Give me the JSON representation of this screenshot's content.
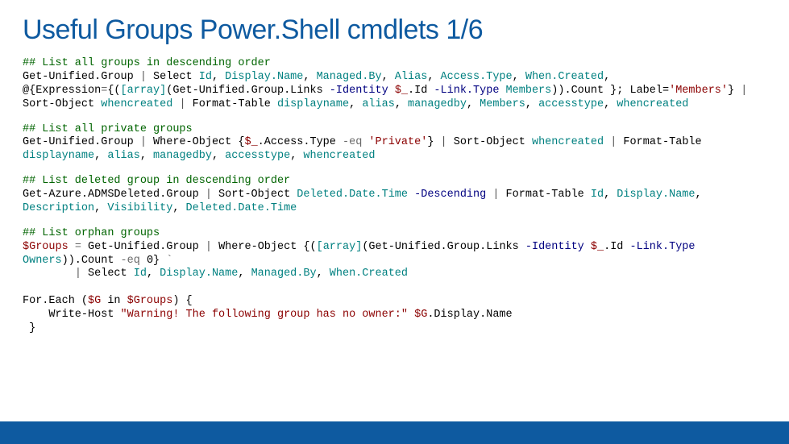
{
  "title": "Useful Groups Power.Shell cmdlets 1/6",
  "sections": [
    {
      "comment": "## List all groups in descending order",
      "tokens": [
        {
          "t": "Get-Unified.Group ",
          "c": ""
        },
        {
          "t": "|",
          "c": "pipe"
        },
        {
          "t": " Select ",
          "c": ""
        },
        {
          "t": "Id",
          "c": "teal"
        },
        {
          "t": ", ",
          "c": ""
        },
        {
          "t": "Display.Name",
          "c": "teal"
        },
        {
          "t": ", ",
          "c": ""
        },
        {
          "t": "Managed.By",
          "c": "teal"
        },
        {
          "t": ", ",
          "c": ""
        },
        {
          "t": "Alias",
          "c": "teal"
        },
        {
          "t": ", ",
          "c": ""
        },
        {
          "t": "Access.Type",
          "c": "teal"
        },
        {
          "t": ", ",
          "c": ""
        },
        {
          "t": "When.Created",
          "c": "teal"
        },
        {
          "t": ",\n",
          "c": ""
        },
        {
          "t": "@{Expression",
          "c": ""
        },
        {
          "t": "=",
          "c": "op"
        },
        {
          "t": "{(",
          "c": ""
        },
        {
          "t": "[array]",
          "c": "teal"
        },
        {
          "t": "(Get-Unified.Group.Links ",
          "c": ""
        },
        {
          "t": "-Identity ",
          "c": "blue"
        },
        {
          "t": "$_",
          "c": "darkred"
        },
        {
          "t": ".Id ",
          "c": ""
        },
        {
          "t": "-Link.Type ",
          "c": "blue"
        },
        {
          "t": "Members",
          "c": "teal"
        },
        {
          "t": ")).Count }; Label=",
          "c": ""
        },
        {
          "t": "'Members'",
          "c": "darkred"
        },
        {
          "t": "} ",
          "c": ""
        },
        {
          "t": "|",
          "c": "pipe"
        },
        {
          "t": "\nSort-Object ",
          "c": ""
        },
        {
          "t": "whencreated",
          "c": "teal"
        },
        {
          "t": " ",
          "c": ""
        },
        {
          "t": "|",
          "c": "pipe"
        },
        {
          "t": " Format-Table ",
          "c": ""
        },
        {
          "t": "displayname",
          "c": "teal"
        },
        {
          "t": ", ",
          "c": ""
        },
        {
          "t": "alias",
          "c": "teal"
        },
        {
          "t": ", ",
          "c": ""
        },
        {
          "t": "managedby",
          "c": "teal"
        },
        {
          "t": ", ",
          "c": ""
        },
        {
          "t": "Members",
          "c": "teal"
        },
        {
          "t": ", ",
          "c": ""
        },
        {
          "t": "accesstype",
          "c": "teal"
        },
        {
          "t": ", ",
          "c": ""
        },
        {
          "t": "whencreated",
          "c": "teal"
        }
      ]
    },
    {
      "comment": "## List all private groups",
      "tokens": [
        {
          "t": "Get-Unified.Group ",
          "c": ""
        },
        {
          "t": "|",
          "c": "pipe"
        },
        {
          "t": " Where-Object {",
          "c": ""
        },
        {
          "t": "$_",
          "c": "darkred"
        },
        {
          "t": ".Access.Type ",
          "c": ""
        },
        {
          "t": "-eq ",
          "c": "op"
        },
        {
          "t": "'Private'",
          "c": "darkred"
        },
        {
          "t": "} ",
          "c": ""
        },
        {
          "t": "|",
          "c": "pipe"
        },
        {
          "t": " Sort-Object ",
          "c": ""
        },
        {
          "t": "whencreated",
          "c": "teal"
        },
        {
          "t": " ",
          "c": ""
        },
        {
          "t": "|",
          "c": "pipe"
        },
        {
          "t": " Format-Table\n",
          "c": ""
        },
        {
          "t": "displayname",
          "c": "teal"
        },
        {
          "t": ", ",
          "c": ""
        },
        {
          "t": "alias",
          "c": "teal"
        },
        {
          "t": ", ",
          "c": ""
        },
        {
          "t": "managedby",
          "c": "teal"
        },
        {
          "t": ", ",
          "c": ""
        },
        {
          "t": "accesstype",
          "c": "teal"
        },
        {
          "t": ", ",
          "c": ""
        },
        {
          "t": "whencreated",
          "c": "teal"
        }
      ]
    },
    {
      "comment": "## List deleted group in descending order",
      "tokens": [
        {
          "t": "Get-Azure.ADMSDeleted.Group ",
          "c": ""
        },
        {
          "t": "|",
          "c": "pipe"
        },
        {
          "t": " Sort-Object ",
          "c": ""
        },
        {
          "t": "Deleted.Date.Time",
          "c": "teal"
        },
        {
          "t": " ",
          "c": ""
        },
        {
          "t": "-Descending ",
          "c": "blue"
        },
        {
          "t": "|",
          "c": "pipe"
        },
        {
          "t": " Format-Table ",
          "c": ""
        },
        {
          "t": "Id",
          "c": "teal"
        },
        {
          "t": ", ",
          "c": ""
        },
        {
          "t": "Display.Name",
          "c": "teal"
        },
        {
          "t": ",\n",
          "c": ""
        },
        {
          "t": "Description",
          "c": "teal"
        },
        {
          "t": ", ",
          "c": ""
        },
        {
          "t": "Visibility",
          "c": "teal"
        },
        {
          "t": ", ",
          "c": ""
        },
        {
          "t": "Deleted.Date.Time",
          "c": "teal"
        }
      ]
    },
    {
      "comment": "## List orphan groups",
      "tokens": [
        {
          "t": "$Groups",
          "c": "darkred"
        },
        {
          "t": " ",
          "c": ""
        },
        {
          "t": "=",
          "c": "op"
        },
        {
          "t": " Get-Unified.Group ",
          "c": ""
        },
        {
          "t": "|",
          "c": "pipe"
        },
        {
          "t": " Where-Object {(",
          "c": ""
        },
        {
          "t": "[array]",
          "c": "teal"
        },
        {
          "t": "(Get-Unified.Group.Links ",
          "c": ""
        },
        {
          "t": "-Identity ",
          "c": "blue"
        },
        {
          "t": "$_",
          "c": "darkred"
        },
        {
          "t": ".Id ",
          "c": ""
        },
        {
          "t": "-Link.Type\n",
          "c": "blue"
        },
        {
          "t": "Owners",
          "c": "teal"
        },
        {
          "t": ")).Count ",
          "c": ""
        },
        {
          "t": "-eq ",
          "c": "op"
        },
        {
          "t": "0} ",
          "c": ""
        },
        {
          "t": "`",
          "c": "op"
        },
        {
          "t": "\n        ",
          "c": ""
        },
        {
          "t": "|",
          "c": "pipe"
        },
        {
          "t": " Select ",
          "c": ""
        },
        {
          "t": "Id",
          "c": "teal"
        },
        {
          "t": ", ",
          "c": ""
        },
        {
          "t": "Display.Name",
          "c": "teal"
        },
        {
          "t": ", ",
          "c": ""
        },
        {
          "t": "Managed.By",
          "c": "teal"
        },
        {
          "t": ", ",
          "c": ""
        },
        {
          "t": "When.Created",
          "c": "teal"
        },
        {
          "t": "\n\n",
          "c": ""
        },
        {
          "t": "For.Each (",
          "c": ""
        },
        {
          "t": "$G",
          "c": "darkred"
        },
        {
          "t": " in ",
          "c": ""
        },
        {
          "t": "$Groups",
          "c": "darkred"
        },
        {
          "t": ") {\n    Write-Host ",
          "c": ""
        },
        {
          "t": "\"Warning! The following group has no owner:\"",
          "c": "darkred"
        },
        {
          "t": " ",
          "c": ""
        },
        {
          "t": "$G",
          "c": "darkred"
        },
        {
          "t": ".Display.Name\n }",
          "c": ""
        }
      ]
    }
  ]
}
